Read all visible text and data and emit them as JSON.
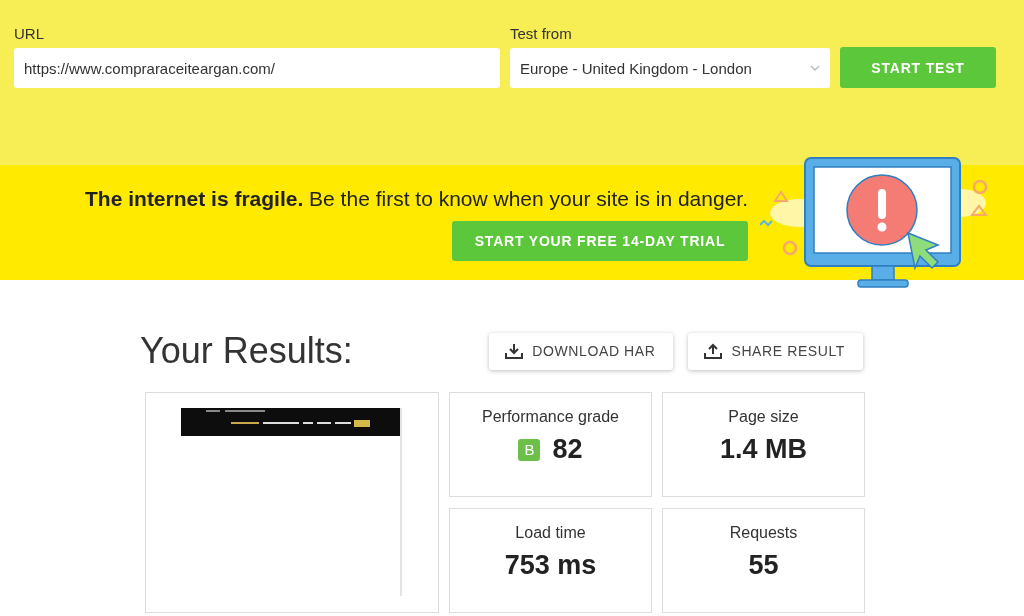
{
  "form": {
    "url_label": "URL",
    "url_value": "https://www.compraraceiteargan.com/",
    "location_label": "Test from",
    "location_value": "Europe - United Kingdom - London",
    "start_button": "START TEST"
  },
  "banner": {
    "headline": "The internet is fragile.",
    "message": "Be the first to know when your site is in danger.",
    "trial_button": "START YOUR FREE 14-DAY TRIAL"
  },
  "results": {
    "title": "Your Results:",
    "actions": [
      {
        "label": "DOWNLOAD HAR",
        "kind": "download"
      },
      {
        "label": "SHARE RESULT",
        "kind": "share"
      }
    ],
    "metrics": [
      {
        "label": "Performance grade",
        "value": "82",
        "grade": "B",
        "color": "#6cc04a"
      },
      {
        "label": "Page size",
        "value": "1.4 MB"
      },
      {
        "label": "Load time",
        "value": "753 ms"
      },
      {
        "label": "Requests",
        "value": "55"
      }
    ]
  }
}
